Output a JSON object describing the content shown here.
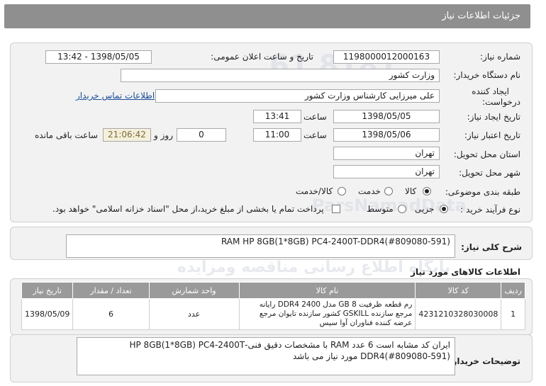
{
  "header": {
    "title": "جزئیات اطلاعات نیاز"
  },
  "form": {
    "need_number_label": "شماره نیاز:",
    "need_number": "1198000012000163",
    "announce_label": "تاریخ و ساعت اعلان عمومی:",
    "announce_value": "1398/05/05 - 13:42",
    "buyer_org_label": "نام دستگاه خریدار:",
    "buyer_org": "وزارت کشور",
    "creator_label_1": "ایجاد کننده",
    "creator_label_2": "درخواست:",
    "creator": "علی میرزایی کارشناس وزارت کشور",
    "contact_link": "اطلاعات تماس خریدار",
    "created_label": "تاریخ ایجاد نیاز:",
    "created_date": "1398/05/05",
    "time_label": "ساعت",
    "created_time": "13:41",
    "validity_label": "تاریخ اعتبار نیاز:",
    "validity_date": "1398/05/06",
    "validity_time": "11:00",
    "days": "0",
    "days_label": "روز و",
    "remaining_time": "21:06:42",
    "remaining_label": "ساعت باقی مانده",
    "province_label": "استان محل تحویل:",
    "province": "تهران",
    "city_label": "شهر محل تحویل:",
    "city": "تهران",
    "category_label": "طبقه بندی موضوعی:",
    "category_options": [
      "کالا",
      "خدمت",
      "کالا/خدمت"
    ],
    "process_label": "نوع فرآیند خرید :",
    "process_options": [
      "جزیی",
      "متوسط"
    ],
    "payment_note": "پرداخت تمام یا بخشی از مبلغ خرید،از محل \"اسناد خزانه اسلامی\" خواهد بود."
  },
  "summary": {
    "label": "شرح کلی نیاز:",
    "value": "RAM HP 8GB(1*8GB) PC4-2400T-DDR4(#809080-591)"
  },
  "goods": {
    "section_title": "اطلاعات کالاهای مورد نیاز",
    "columns": [
      "ردیف",
      "کد کالا",
      "نام کالا",
      "واحد شمارش",
      "تعداد / مقدار",
      "تاریخ نیاز"
    ],
    "rows": [
      {
        "index": "1",
        "code": "4231210328030008",
        "name": "رم قطعه ظرفیت 8 GB مدل DDR4 2400 رایانه مرجع سازنده GSKILL کشور سازنده تایوان مرجع عرضه کننده فناوران آوا سیس",
        "unit": "عدد",
        "qty": "6",
        "date": "1398/05/09"
      }
    ]
  },
  "buyer_notes": {
    "label": "توضیحات خریدار:",
    "line1": "ایران کد مشابه است 6 عدد RAM  با مشخصات دقیق فنی-HP 8GB(1*8GB) PC4-2400T",
    "line2": "DDR4(#809080-591) مورد نیاز می باشد"
  },
  "watermark": {
    "site": "ParsNamadData",
    "brand": "پارس نماد داده ها",
    "line": "پایگاه اطلاع رسانی مناقصه ومزایده",
    "phone": "۰۲۱-۸۸۳۴۹۶۷۰"
  }
}
